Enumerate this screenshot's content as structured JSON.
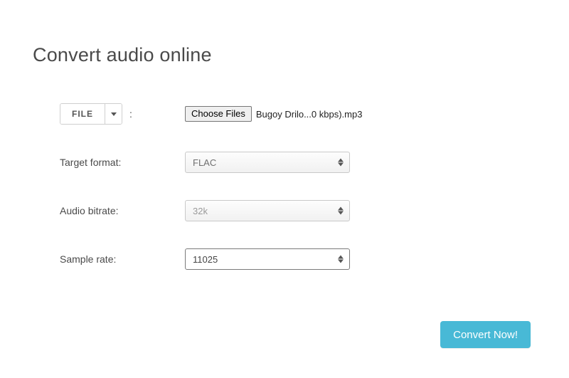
{
  "title": "Convert audio online",
  "file": {
    "button_label": "FILE",
    "colon": ":",
    "choose_label": "Choose Files",
    "selected_filename": "Bugoy Drilo...0 kbps).mp3"
  },
  "format": {
    "label": "Target format:",
    "value": "FLAC"
  },
  "bitrate": {
    "label": "Audio bitrate:",
    "value": "32k"
  },
  "samplerate": {
    "label": "Sample rate:",
    "value": "11025"
  },
  "convert_label": "Convert Now!"
}
